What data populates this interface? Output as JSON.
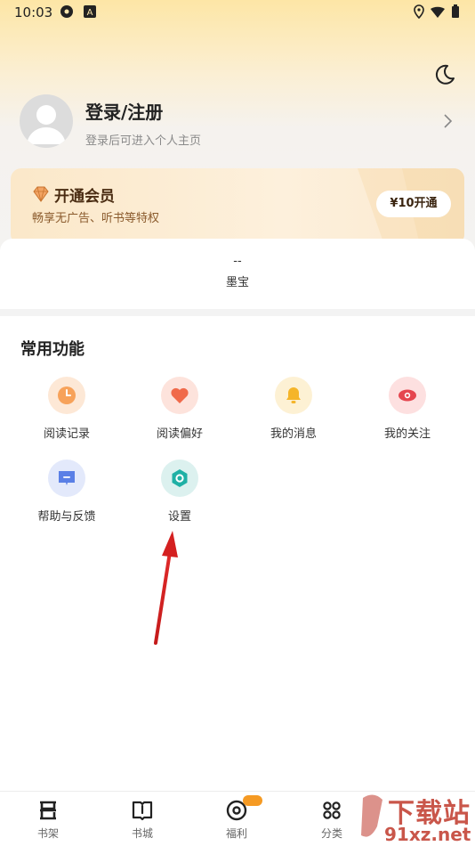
{
  "status_bar": {
    "time": "10:03"
  },
  "profile": {
    "title": "登录/注册",
    "subtitle": "登录后可进入个人主页"
  },
  "vip": {
    "title": "开通会员",
    "subtitle": "畅享无广告、听书等特权",
    "button": "¥10开通"
  },
  "coins": {
    "value": "--",
    "label": "墨宝"
  },
  "functions": {
    "title": "常用功能",
    "items": [
      {
        "label": "阅读记录",
        "icon": "clock-icon",
        "color": "#f7a25a"
      },
      {
        "label": "阅读偏好",
        "icon": "heart-icon",
        "color": "#f06a4a"
      },
      {
        "label": "我的消息",
        "icon": "bell-icon",
        "color": "#f5b52a"
      },
      {
        "label": "我的关注",
        "icon": "eye-icon",
        "color": "#e5464f"
      },
      {
        "label": "帮助与反馈",
        "icon": "message-icon",
        "color": "#5a7fe6"
      },
      {
        "label": "设置",
        "icon": "hexagon-settings-icon",
        "color": "#1fb0a5"
      }
    ]
  },
  "tabbar": {
    "items": [
      {
        "label": "书架",
        "icon": "bookshelf-icon"
      },
      {
        "label": "书城",
        "icon": "book-open-icon"
      },
      {
        "label": "福利",
        "icon": "coin-icon"
      },
      {
        "label": "分类",
        "icon": "grid-icon"
      }
    ]
  },
  "watermark": {
    "line1": "下载站",
    "line2": "91xz.net"
  }
}
